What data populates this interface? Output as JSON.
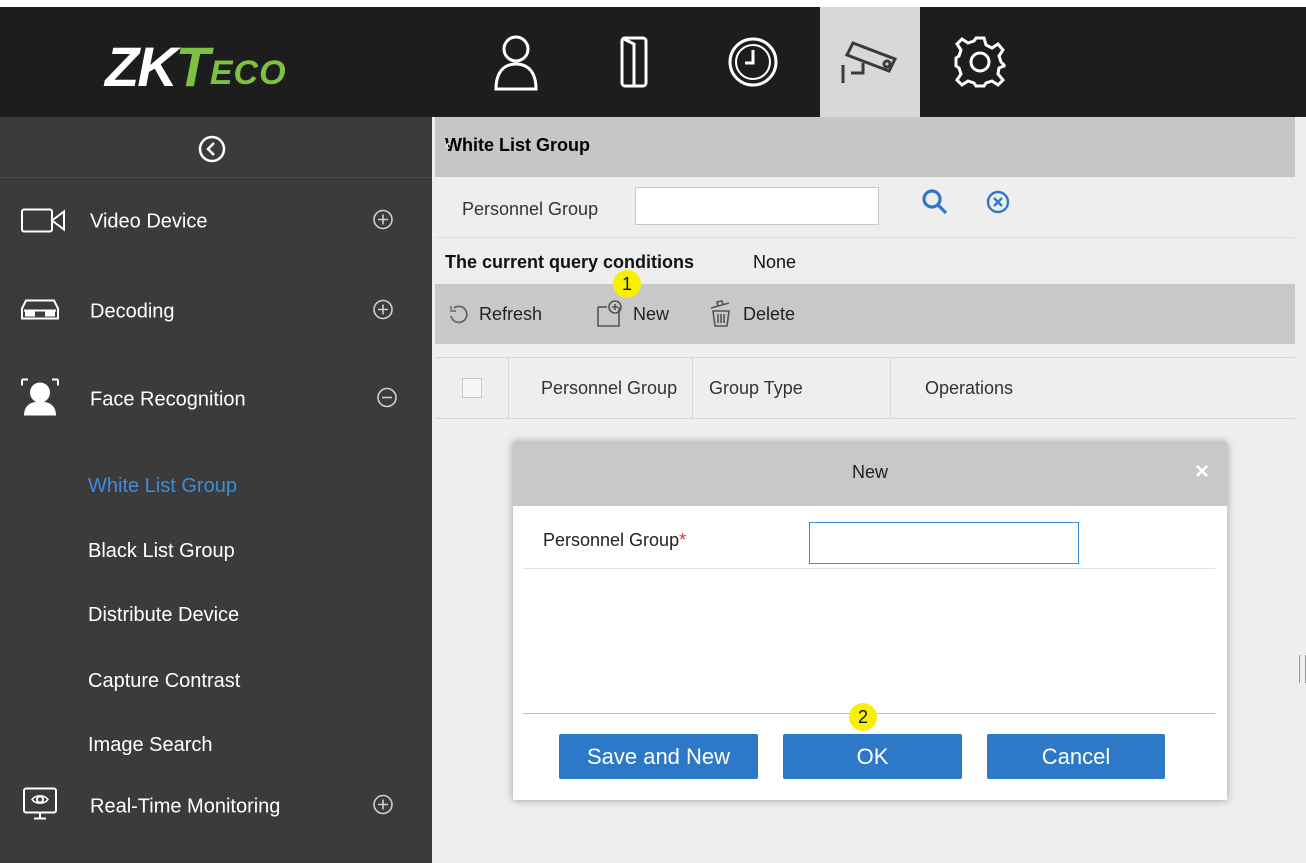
{
  "header": {
    "logo": {
      "main": "ZK",
      "t": "T",
      "eco": "ECO"
    },
    "nav_icons": [
      "person-icon",
      "door-icon",
      "clock-icon",
      "camera-icon",
      "gear-icon"
    ],
    "active_nav": "camera-icon"
  },
  "sidebar": {
    "menus": [
      {
        "label": "Video Device",
        "icon": "video-camera-icon",
        "toggle": "expand-icon"
      },
      {
        "label": "Decoding",
        "icon": "decoder-icon",
        "toggle": "expand-icon"
      },
      {
        "label": "Face Recognition",
        "icon": "face-icon",
        "toggle": "collapse-icon"
      },
      {
        "label": "Real-Time Monitoring",
        "icon": "monitor-icon",
        "toggle": "expand-icon"
      }
    ],
    "sub_items": [
      {
        "label": "White List Group",
        "active": true
      },
      {
        "label": "Black List Group",
        "active": false
      },
      {
        "label": "Distribute Device",
        "active": false
      },
      {
        "label": "Capture Contrast",
        "active": false
      },
      {
        "label": "Image Search",
        "active": false
      }
    ]
  },
  "main": {
    "title": "White List Group",
    "filter": {
      "label": "Personnel Group",
      "value": ""
    },
    "query": {
      "label": "The current query conditions",
      "value": "None"
    },
    "toolbar": {
      "refresh": "Refresh",
      "new": "New",
      "delete": "Delete"
    },
    "table": {
      "columns": [
        "Personnel Group",
        "Group Type",
        "Operations"
      ]
    }
  },
  "dialog": {
    "title": "New",
    "close": "×",
    "field_label": "Personnel Group",
    "required_mark": "*",
    "field_value": "",
    "buttons": {
      "save_new": "Save and New",
      "ok": "OK",
      "cancel": "Cancel"
    }
  },
  "markers": {
    "first": "1",
    "second": "2"
  },
  "colors": {
    "accent": "#2e78c8",
    "active_link": "#3c8dd8",
    "marker": "#f8f000",
    "logo_green": "#7cc242",
    "sidebar_bg": "#3b3b3b",
    "topbar_bg": "#1d1d1d"
  }
}
